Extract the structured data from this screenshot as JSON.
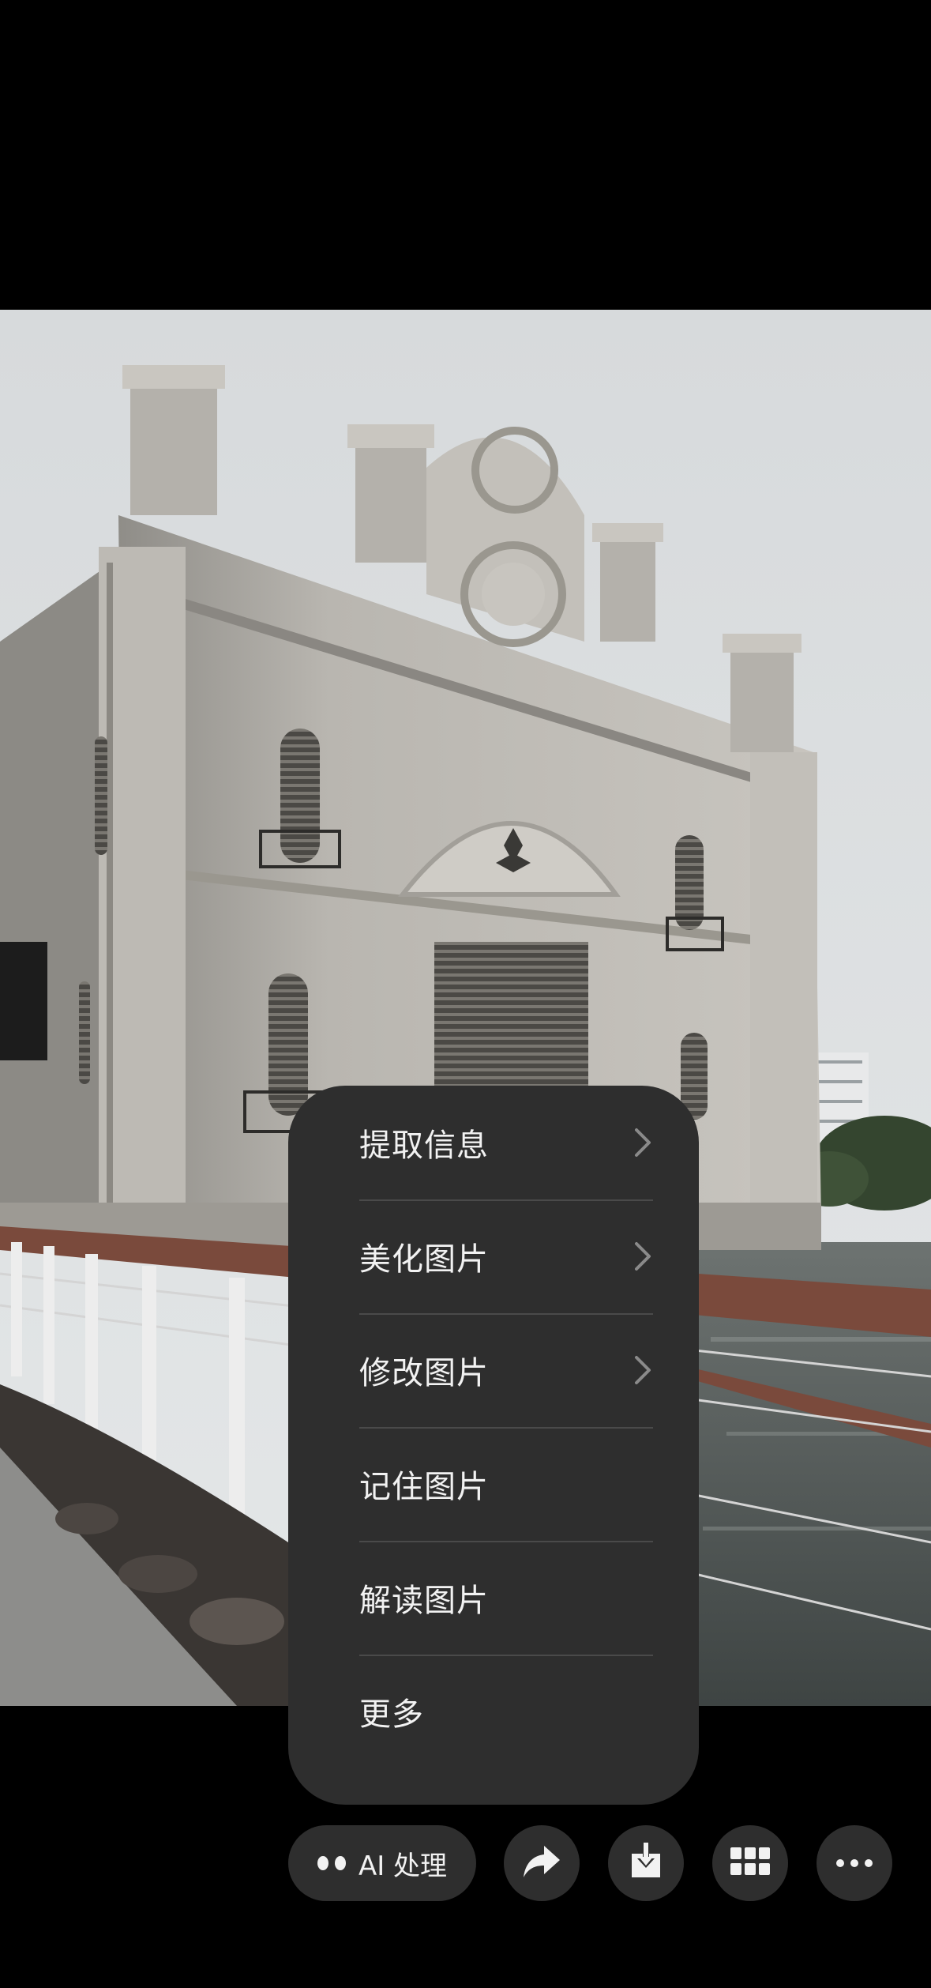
{
  "photo": {
    "description_icon": "photo-building"
  },
  "menu": {
    "items": [
      {
        "label": "提取信息",
        "has_submenu": true
      },
      {
        "label": "美化图片",
        "has_submenu": true
      },
      {
        "label": "修改图片",
        "has_submenu": true
      },
      {
        "label": "记住图片",
        "has_submenu": false
      },
      {
        "label": "解读图片",
        "has_submenu": false
      },
      {
        "label": "更多",
        "has_submenu": false
      }
    ]
  },
  "toolbar": {
    "ai_label": "AI 处理",
    "buttons": [
      {
        "icon": "share-icon"
      },
      {
        "icon": "download-icon"
      },
      {
        "icon": "grid-icon"
      },
      {
        "icon": "more-icon"
      }
    ]
  },
  "colors": {
    "background": "#000000",
    "menu_bg": "#2e2e2e",
    "text": "#f2f2f2",
    "divider": "#4a4a4a"
  }
}
